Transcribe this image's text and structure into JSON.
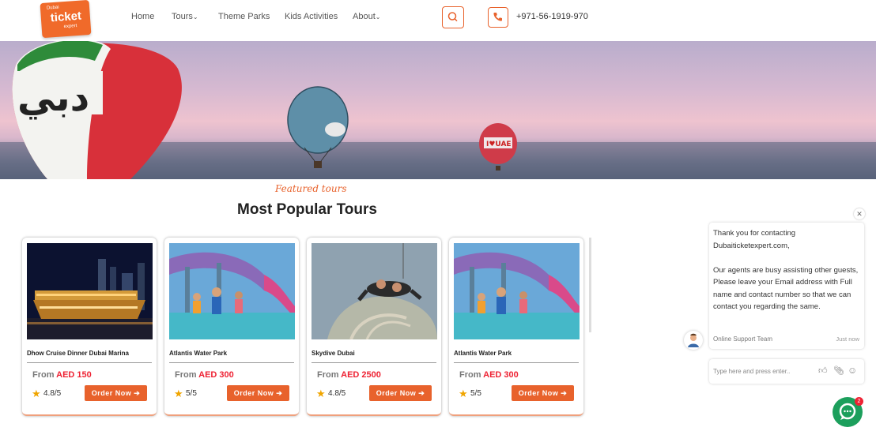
{
  "logo": {
    "line1": "Dubai",
    "line2": "ticket",
    "line3": "expert"
  },
  "nav": [
    {
      "label": "Home"
    },
    {
      "label": "Tours"
    },
    {
      "label": "Theme Parks"
    },
    {
      "label": "Kids Activities"
    },
    {
      "label": "About"
    }
  ],
  "header": {
    "phone": "+971-56-1919-970"
  },
  "section": {
    "kicker": "Featured tours",
    "title": "Most Popular Tours"
  },
  "tours": [
    {
      "name": "Dhow Cruise Dinner Dubai Marina",
      "from": "From",
      "price": "AED 150",
      "rating": "4.8/5",
      "cta": "Order Now"
    },
    {
      "name": "Atlantis Water Park",
      "from": "From",
      "price": "AED 300",
      "rating": "5/5",
      "cta": "Order Now"
    },
    {
      "name": "Skydive Dubai",
      "from": "From",
      "price": "AED 2500",
      "rating": "4.8/5",
      "cta": "Order Now"
    },
    {
      "name": "Atlantis Water Park",
      "from": "From",
      "price": "AED 300",
      "rating": "5/5",
      "cta": "Order Now"
    }
  ],
  "chat": {
    "message": "Thank you for contacting\nDubaiticketexpert.com,\n\nOur agents are busy assisting other guests, Please leave your Email address with Full name and contact number so that we can contact you regarding the same.",
    "team": "Online Support Team",
    "time": "Just now",
    "placeholder": "Type here and press enter..",
    "badge": "2"
  },
  "colors": {
    "accent": "#e8622c",
    "price": "#ee2233",
    "chat": "#1c9f5c"
  }
}
